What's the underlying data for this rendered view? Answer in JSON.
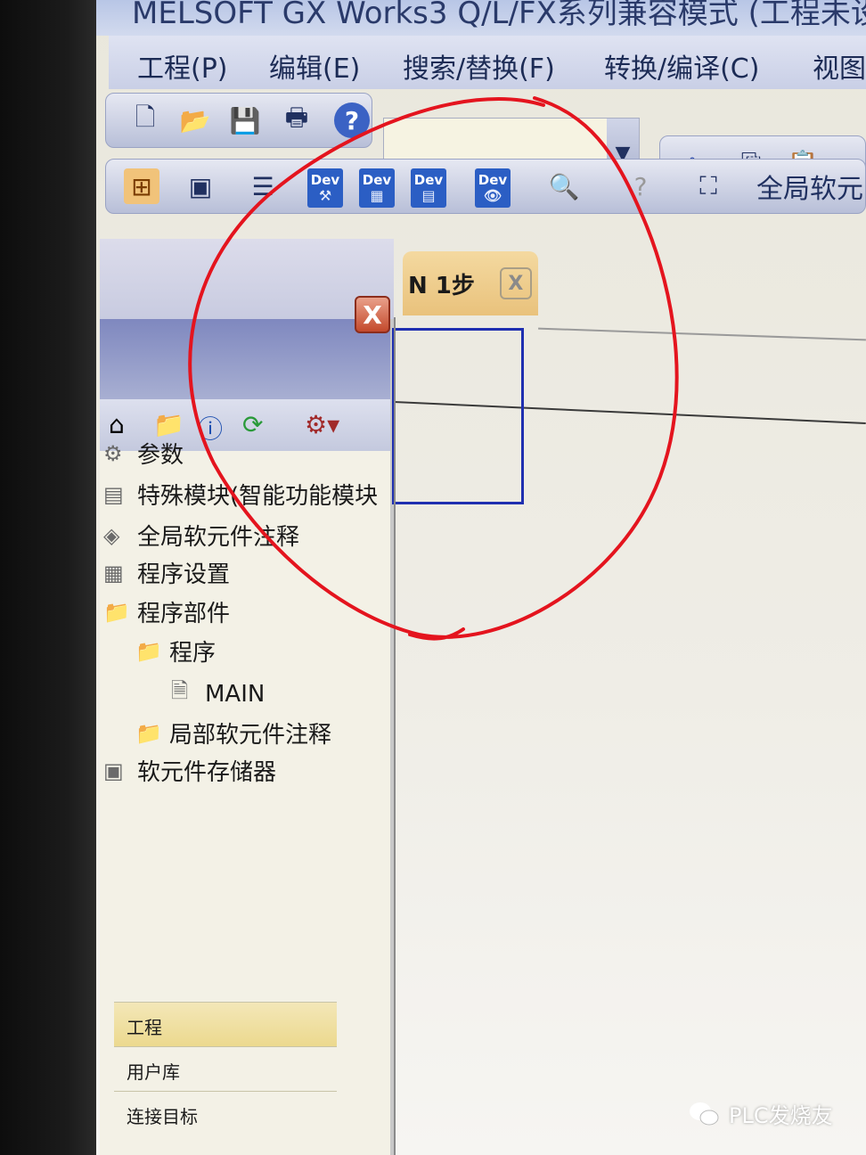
{
  "window": {
    "title": "MELSOFT GX Works3 Q/L/FX系列兼容模式 (工程未设"
  },
  "menu": [
    {
      "label": "工程(P)"
    },
    {
      "label": "编辑(E)"
    },
    {
      "label": "搜索/替换(F)"
    },
    {
      "label": "转换/编译(C)"
    },
    {
      "label": "视图"
    }
  ],
  "toolbar": {
    "help_icon": "?",
    "dev_label": "Dev",
    "global_label": "全局软元"
  },
  "navigation": {
    "close_label": "X",
    "tree": [
      {
        "label": "参数"
      },
      {
        "label": "特殊模块(智能功能模块"
      },
      {
        "label": "全局软元件注释"
      },
      {
        "label": "程序设置"
      },
      {
        "label": "程序部件"
      },
      {
        "label": "程序"
      },
      {
        "label": "MAIN"
      },
      {
        "label": "局部软元件注释"
      },
      {
        "label": "软元件存储器"
      }
    ],
    "bottom_tabs": [
      {
        "label": "工程"
      },
      {
        "label": "用户库"
      },
      {
        "label": "连接目标"
      }
    ]
  },
  "editor": {
    "tab_label": "N 1步",
    "tab_close": "X"
  },
  "annotation": {
    "color": "#e4141e"
  },
  "watermark": {
    "text": "PLC发烧友"
  }
}
